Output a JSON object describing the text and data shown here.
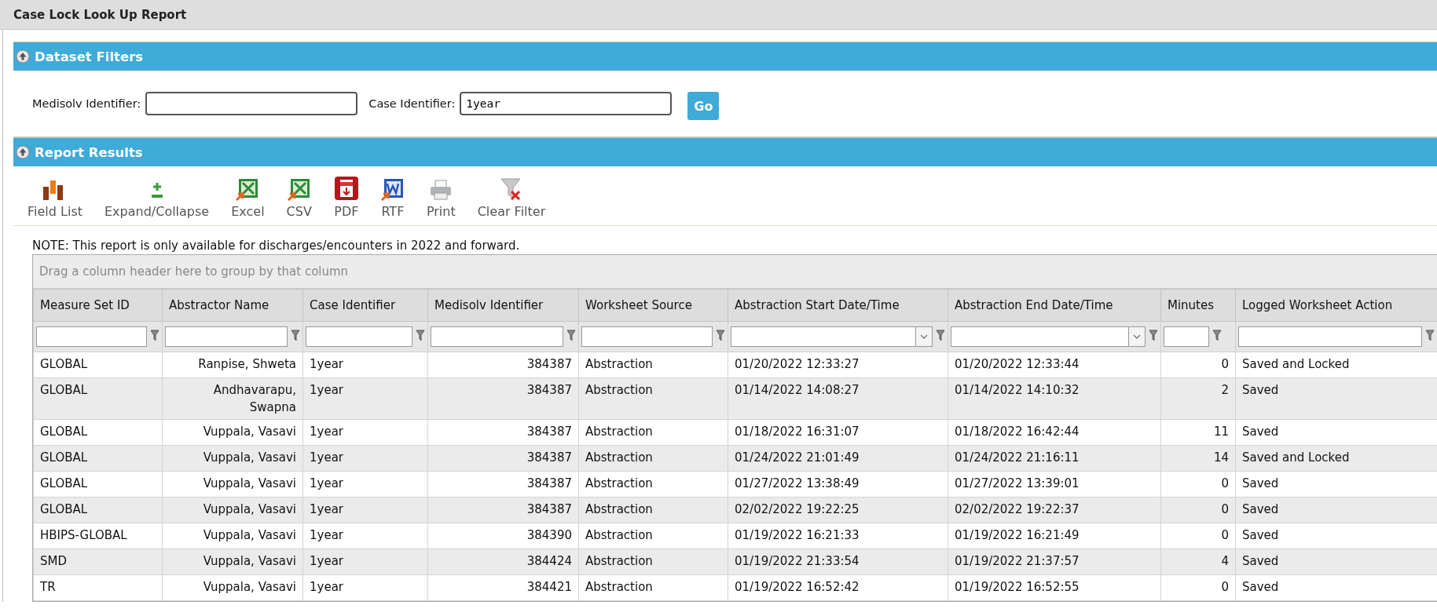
{
  "page_title": "Case Lock Look Up Report",
  "dataset_filters": {
    "title": "Dataset Filters",
    "expanded": true,
    "fields": [
      {
        "label": "Medisolv Identifier:"
      },
      {
        "label": "Case Identifier:",
        "value": "1year"
      }
    ],
    "go_button": "Go"
  },
  "report_results": {
    "title": "Report Results",
    "expanded": true,
    "toolbar": [
      {
        "kind": "field-list",
        "label": "Field List"
      },
      {
        "kind": "expand",
        "label": "Expand/Collapse"
      },
      {
        "kind": "excel",
        "label": "Excel"
      },
      {
        "kind": "csv",
        "label": "CSV"
      },
      {
        "kind": "pdf",
        "label": "PDF"
      },
      {
        "kind": "rtf",
        "label": "RTF"
      },
      {
        "kind": "print",
        "label": "Print"
      },
      {
        "kind": "clear-filter",
        "label": "Clear Filter"
      }
    ],
    "note": "NOTE: This report is only available for discharges/encounters in 2022 and forward.",
    "group_panel": "Drag a column header here to group by that column",
    "columns": [
      {
        "label": "Measure Set ID",
        "kind": "text"
      },
      {
        "label": "Abstractor Name",
        "kind": "text"
      },
      {
        "label": "Case Identifier",
        "kind": "text"
      },
      {
        "label": "Medisolv Identifier",
        "kind": "text"
      },
      {
        "label": "Worksheet Source",
        "kind": "text"
      },
      {
        "label": "Abstraction Start Date/Time",
        "kind": "date"
      },
      {
        "label": "Abstraction End Date/Time",
        "kind": "date"
      },
      {
        "label": "Minutes",
        "kind": "number"
      },
      {
        "label": "Logged Worksheet Action",
        "kind": "text"
      }
    ],
    "rows": [
      [
        "GLOBAL",
        "Ranpise, Shweta",
        "1year",
        "384387",
        "Abstraction",
        "01/20/2022 12:33:27",
        "01/20/2022 12:33:44",
        "0",
        "Saved and Locked"
      ],
      [
        "GLOBAL",
        "Andhavarapu, Swapna",
        "1year",
        "384387",
        "Abstraction",
        "01/14/2022 14:08:27",
        "01/14/2022 14:10:32",
        "2",
        "Saved"
      ],
      [
        "GLOBAL",
        "Vuppala, Vasavi",
        "1year",
        "384387",
        "Abstraction",
        "01/18/2022 16:31:07",
        "01/18/2022 16:42:44",
        "11",
        "Saved"
      ],
      [
        "GLOBAL",
        "Vuppala, Vasavi",
        "1year",
        "384387",
        "Abstraction",
        "01/24/2022 21:01:49",
        "01/24/2022 21:16:11",
        "14",
        "Saved and Locked"
      ],
      [
        "GLOBAL",
        "Vuppala, Vasavi",
        "1year",
        "384387",
        "Abstraction",
        "01/27/2022 13:38:49",
        "01/27/2022 13:39:01",
        "0",
        "Saved"
      ],
      [
        "GLOBAL",
        "Vuppala, Vasavi",
        "1year",
        "384387",
        "Abstraction",
        "02/02/2022 19:22:25",
        "02/02/2022 19:22:37",
        "0",
        "Saved"
      ],
      [
        "HBIPS-GLOBAL",
        "Vuppala, Vasavi",
        "1year",
        "384390",
        "Abstraction",
        "01/19/2022 16:21:33",
        "01/19/2022 16:21:49",
        "0",
        "Saved"
      ],
      [
        "SMD",
        "Vuppala, Vasavi",
        "1year",
        "384424",
        "Abstraction",
        "01/19/2022 21:33:54",
        "01/19/2022 21:37:57",
        "4",
        "Saved"
      ],
      [
        "TR",
        "Vuppala, Vasavi",
        "1year",
        "384421",
        "Abstraction",
        "01/19/2022 16:52:42",
        "01/19/2022 16:52:55",
        "0",
        "Saved"
      ]
    ]
  }
}
